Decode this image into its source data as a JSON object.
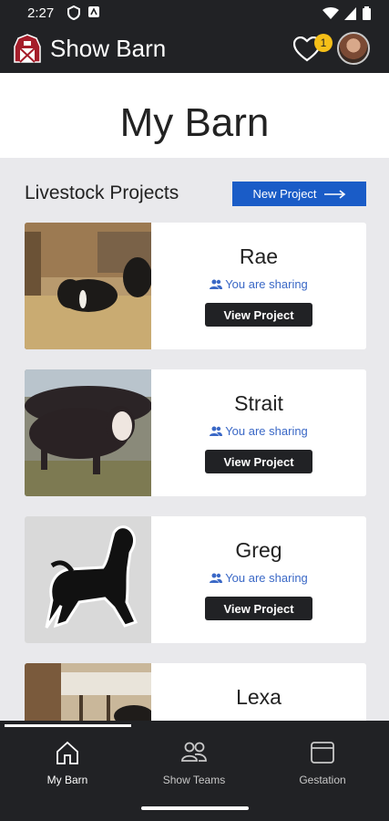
{
  "status_bar": {
    "time": "2:27"
  },
  "app_bar": {
    "title": "Show Barn",
    "notification_count": "1"
  },
  "page": {
    "title": "My Barn"
  },
  "projects_section": {
    "heading": "Livestock Projects",
    "new_project_label": "New Project"
  },
  "projects": [
    {
      "name": "Rae",
      "sharing": "You are sharing",
      "button": "View Project"
    },
    {
      "name": "Strait",
      "sharing": "You are sharing",
      "button": "View Project"
    },
    {
      "name": "Greg",
      "sharing": "You are sharing",
      "button": "View Project"
    },
    {
      "name": "Lexa"
    }
  ],
  "bottom_nav": [
    {
      "label": "My Barn",
      "icon": "home-icon",
      "active": true
    },
    {
      "label": "Show Teams",
      "icon": "people-icon",
      "active": false
    },
    {
      "label": "Gestation",
      "icon": "calendar-icon",
      "active": false
    }
  ],
  "colors": {
    "accent": "#1a5cc7",
    "badge": "#f5bf18",
    "dark": "#212225",
    "share_text": "#3a68c6"
  }
}
